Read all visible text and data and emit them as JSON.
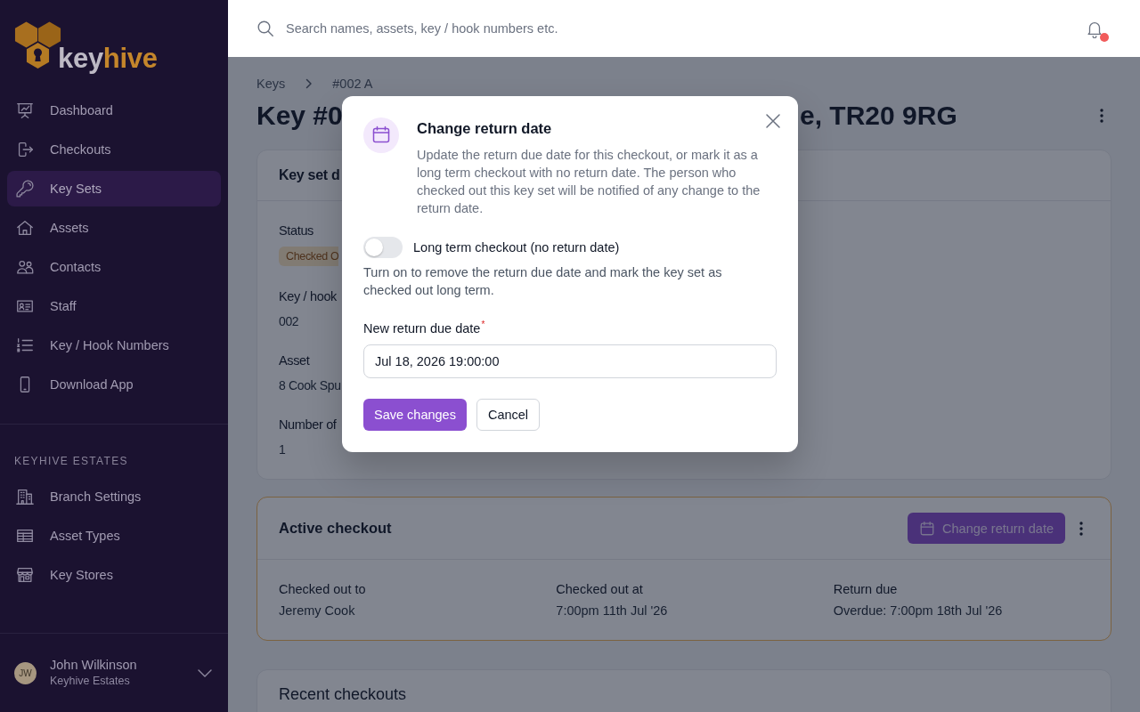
{
  "sidebar": {
    "logo": {
      "first": "key",
      "second": "hive"
    },
    "nav_items": [
      {
        "label": "Dashboard",
        "selected": false
      },
      {
        "label": "Checkouts",
        "selected": false
      },
      {
        "label": "Key Sets",
        "selected": true
      },
      {
        "label": "Assets",
        "selected": false
      },
      {
        "label": "Contacts",
        "selected": false
      },
      {
        "label": "Staff",
        "selected": false
      },
      {
        "label": "Key / Hook Numbers",
        "selected": false
      },
      {
        "label": "Download App",
        "selected": false
      }
    ],
    "section": {
      "heading": "KEYHIVE ESTATES",
      "items": [
        {
          "label": "Branch Settings",
          "selected": false
        },
        {
          "label": "Asset Types",
          "selected": false
        },
        {
          "label": "Key Stores",
          "selected": false
        }
      ]
    },
    "user": {
      "initials": "JW",
      "name": "John Wilkinson",
      "organization": "Keyhive Estates"
    }
  },
  "header": {
    "search": {
      "placeholder": "Search names, assets, key / hook numbers etc."
    },
    "notifications": {
      "unread": true
    }
  },
  "breadcrumb": [
    {
      "label": "Keys"
    },
    {
      "label": "#002 A"
    }
  ],
  "page_title": [
    "Key #0",
    "e, TR20 9RG"
  ],
  "key_set_card": {
    "title": "Key set d",
    "fields": [
      {
        "label": "Status",
        "value": "Checked O",
        "kind": "badge"
      },
      {
        "label": "Key / hook",
        "value": "002",
        "kind": "text"
      },
      {
        "label": "Asset",
        "value": "8 Cook Spu",
        "kind": "text"
      },
      {
        "label": "Number of",
        "value": "1",
        "kind": "text"
      }
    ]
  },
  "active_checkout": {
    "title": "Active checkout",
    "action": "Change return date",
    "fields": [
      {
        "label": "Checked out to",
        "value": "Jeremy Cook"
      },
      {
        "label": "Checked out at",
        "value": "7:00pm 11th Jul '26"
      },
      {
        "label": "Return due",
        "value": "Overdue: 7:00pm 18th Jul '26"
      }
    ]
  },
  "recent_checkouts": {
    "title": "Recent checkouts"
  },
  "modal": {
    "title": "Change return date",
    "description": "Update the return due date for this checkout, or mark it as a long term checkout with no return date. The person who checked out this key set will be notified of any change to the return date.",
    "toggle": {
      "label": "Long term checkout (no return date)",
      "on": false,
      "help": "Turn on to remove the return due date and mark the key set as checked out long term."
    },
    "date_field": {
      "label": "New return due date",
      "required_mark": "*",
      "value": "Jul 18, 2026 19:00:00"
    },
    "buttons": [
      {
        "label": "Save changes",
        "kind": "primary"
      },
      {
        "label": "Cancel",
        "kind": "secondary"
      }
    ]
  }
}
